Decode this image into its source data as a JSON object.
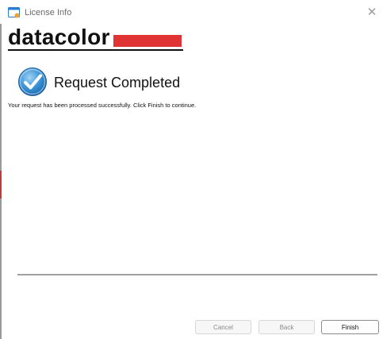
{
  "window": {
    "title": "License Info",
    "close_glyph": "✕"
  },
  "logo": {
    "text": "datacolor",
    "accent_color": "#e03333"
  },
  "status": {
    "icon": "check-icon",
    "heading": "Request Completed",
    "message": "Your request has been processed successfully.  Click Finish to continue."
  },
  "buttons": {
    "cancel": "Cancel",
    "back": "Back",
    "finish": "Finish"
  }
}
